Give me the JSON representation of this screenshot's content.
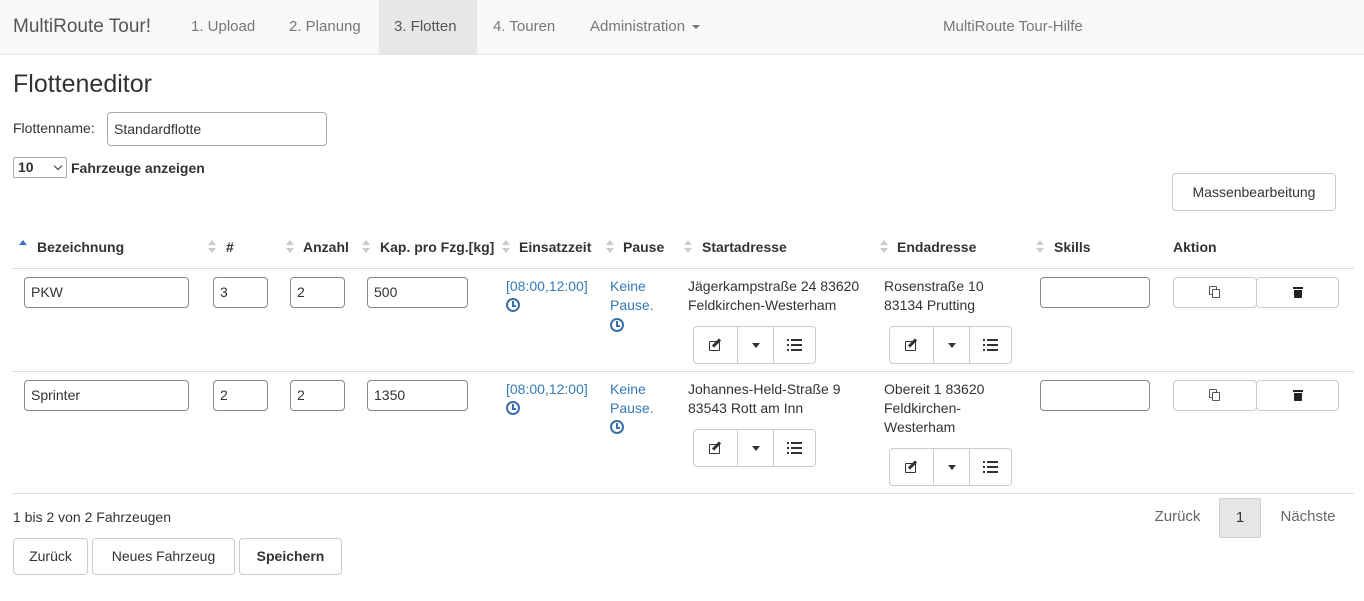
{
  "navbar": {
    "brand": "MultiRoute Tour!",
    "items": [
      {
        "label": "1. Upload"
      },
      {
        "label": "2. Planung"
      },
      {
        "label": "3. Flotten",
        "active": true
      },
      {
        "label": "4. Touren"
      },
      {
        "label": "Administration"
      }
    ],
    "help": "MultiRoute Tour-Hilfe"
  },
  "page": {
    "title": "Flotteneditor",
    "fleet_name_label": "Flottenname:",
    "fleet_name_value": "Standardflotte"
  },
  "table_controls": {
    "length_value": "10",
    "length_label": "Fahrzeuge anzeigen",
    "mass_edit_label": "Massenbearbeitung"
  },
  "table": {
    "headers": {
      "bezeichnung": "Bezeichnung",
      "nummer": "#",
      "anzahl": "Anzahl",
      "kapazitaet": "Kap. pro Fzg.[kg]",
      "einsatzzeit": "Einsatzzeit",
      "pause": "Pause",
      "startadresse": "Startadresse",
      "endadresse": "Endadresse",
      "skills": "Skills",
      "aktion": "Aktion"
    },
    "rows": [
      {
        "bezeichnung": "PKW",
        "nummer": "3",
        "anzahl": "2",
        "kapazitaet": "500",
        "einsatzzeit": "[08:00,12:00]",
        "pause_line1": "Keine",
        "pause_line2": "Pause.",
        "start_line1": "Jägerkampstraße 24 83620",
        "start_line2": "Feldkirchen-Westerham",
        "end_line1": "Rosenstraße 10",
        "end_line2": "83134 Prutting",
        "end_line3": "",
        "skills": ""
      },
      {
        "bezeichnung": "Sprinter",
        "nummer": "2",
        "anzahl": "2",
        "kapazitaet": "1350",
        "einsatzzeit": "[08:00,12:00]",
        "pause_line1": "Keine",
        "pause_line2": "Pause.",
        "start_line1": "Johannes-Held-Straße 9",
        "start_line2": "83543 Rott am Inn",
        "end_line1": "Obereit 1 83620",
        "end_line2": "Feldkirchen-",
        "end_line3": "Westerham",
        "skills": ""
      }
    ]
  },
  "footer": {
    "info": "1 bis 2 von 2 Fahrzeugen",
    "pagination": {
      "prev": "Zurück",
      "current": "1",
      "next": "Nächste"
    },
    "buttons": {
      "back": "Zurück",
      "new_vehicle": "Neues Fahrzeug",
      "save": "Speichern"
    }
  }
}
